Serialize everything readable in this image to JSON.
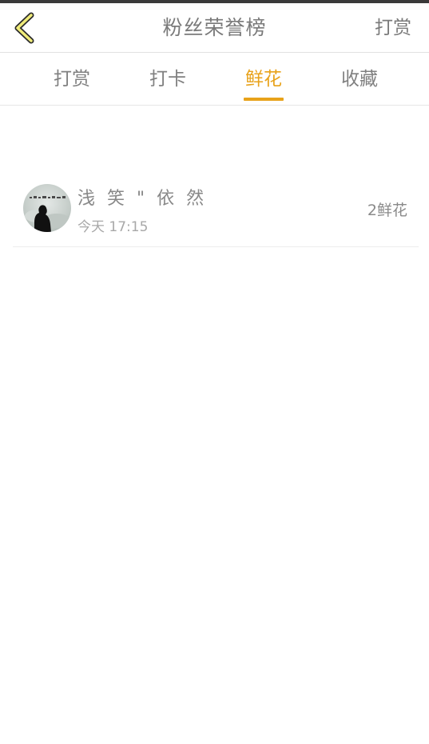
{
  "header": {
    "back_icon": "chevron-left-icon",
    "title": "粉丝荣誉榜",
    "action_label": "打赏"
  },
  "tabs": [
    {
      "label": "打赏",
      "active": false
    },
    {
      "label": "打卡",
      "active": false
    },
    {
      "label": "鲜花",
      "active": true
    },
    {
      "label": "收藏",
      "active": false
    }
  ],
  "colors": {
    "accent": "#e8a21a",
    "back_icon_fill": "#f0ec7a",
    "text_gray": "#7a7a7a"
  },
  "fans": [
    {
      "name": "浅 笑 \" 依 然",
      "time": "今天 17:15",
      "amount": "2鲜花"
    }
  ]
}
